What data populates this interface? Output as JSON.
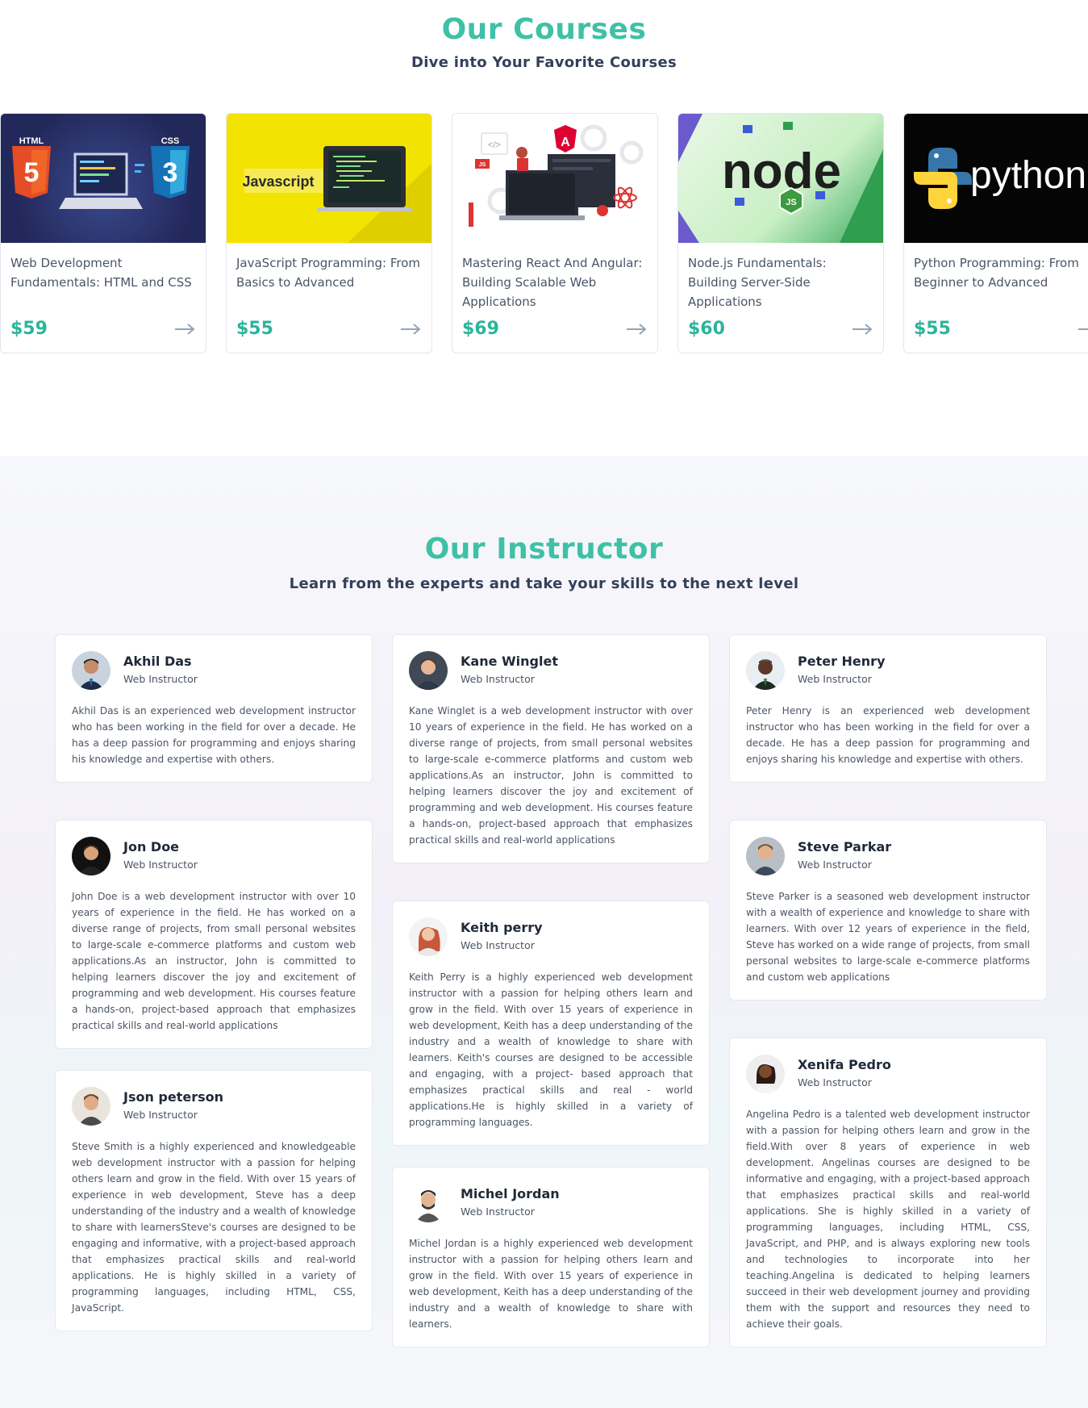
{
  "courses_section": {
    "title": "Our Courses",
    "subtitle": "Dive into Your Favorite Courses",
    "courses": [
      {
        "name": "Web Development Fundamentals: HTML and CSS",
        "price": "$59",
        "thumb_text": [
          "HTML",
          "CSS"
        ]
      },
      {
        "name": "JavaScript Programming: From Basics to Advanced",
        "price": "$55",
        "thumb_text": [
          "Javascript"
        ]
      },
      {
        "name": "Mastering React And Angular: Building Scalable Web Applications",
        "price": "$69",
        "thumb_text": [
          "</>",
          "JS"
        ]
      },
      {
        "name": "Node.js Fundamentals: Building Server-Side Applications",
        "price": "$60",
        "thumb_text": [
          "node",
          "JS"
        ]
      },
      {
        "name": "Python Programming: From Beginner to Advanced",
        "price": "$55",
        "thumb_text": [
          "python"
        ]
      }
    ]
  },
  "instructors_section": {
    "title": "Our Instructor",
    "subtitle": "Learn from the experts and take your skills to the next level",
    "instructors": [
      {
        "name": "Akhil Das",
        "role": "Web Instructor",
        "bio": "Akhil Das is an experienced web development instructor who has been working in the field for over a decade. He has a deep passion for programming and enjoys sharing his knowledge and expertise with others."
      },
      {
        "name": "Jon Doe",
        "role": "Web Instructor",
        "bio": "John Doe is a web development instructor with over 10 years of experience in the field. He has worked on a diverse range of projects, from small personal websites to large-scale e-commerce platforms and custom web applications.As an instructor, John is committed to helping learners discover the joy and excitement of programming and web development. His courses feature a hands-on, project-based approach that emphasizes practical skills and real-world applications"
      },
      {
        "name": "Json peterson",
        "role": "Web Instructor",
        "bio": "Steve Smith is a highly experienced and knowledgeable web development instructor with a passion for helping others learn and grow in the field. With over 15 years of experience in web development, Steve has a deep understanding of the industry and a wealth of knowledge to share with learnersSteve's courses are designed to be engaging and informative, with a project-based approach that emphasizes practical skills and real-world applications. He is highly skilled in a variety of programming languages, including HTML, CSS, JavaScript."
      },
      {
        "name": "Kane Winglet",
        "role": "Web Instructor",
        "bio": "Kane Winglet is a web development instructor with over 10 years of experience in the field. He has worked on a diverse range of projects, from small personal websites to large-scale e-commerce platforms and custom web applications.As an instructor, John is committed to helping learners discover the joy and excitement of programming and web development. His courses feature a hands-on, project-based approach that emphasizes practical skills and real-world applications"
      },
      {
        "name": "Keith perry",
        "role": "Web Instructor",
        "bio": "Keith Perry is a highly experienced web development instructor with a passion for helping others learn and grow in the field. With over 15 years of experience in web development, Keith has a deep understanding of the industry and a wealth of knowledge to share with learners. Keith's courses are designed to be accessible and engaging, with a project- based approach that emphasizes practical skills and real - world applications.He is highly skilled in a variety of programming languages."
      },
      {
        "name": "Michel Jordan",
        "role": "Web Instructor",
        "bio": "Michel Jordan is a highly experienced web development instructor with a passion for helping others learn and grow in the field. With over 15 years of experience in web development, Keith has a deep understanding of the industry and a wealth of knowledge to share with learners."
      },
      {
        "name": "Peter Henry",
        "role": "Web Instructor",
        "bio": "Peter Henry is an experienced web development instructor who has been working in the field for over a decade. He has a deep passion for programming and enjoys sharing his knowledge and expertise with others."
      },
      {
        "name": "Steve Parkar",
        "role": "Web Instructor",
        "bio": "Steve Parker is a seasoned web development instructor with a wealth of experience and knowledge to share with learners. With over 12 years of experience in the field, Steve has worked on a wide range of projects, from small personal websites to large-scale e-commerce platforms and custom web applications"
      },
      {
        "name": "Xenifa Pedro",
        "role": "Web Instructor",
        "bio": "Angelina Pedro is a talented web development instructor with a passion for helping others learn and grow in the field.With over 8 years of experience in web development. Angelinas courses are designed to be informative and engaging, with a project-based approach that emphasizes practical skills and real-world applications. She is highly skilled in a variety of programming languages, including HTML, CSS, JavaScript, and PHP, and is always exploring new tools and technologies to incorporate into her teaching.Angelina is dedicated to helping learners succeed in their web development journey and providing them with the support and resources they need to achieve their goals."
      }
    ]
  },
  "colors": {
    "accent": "#3ec1a6",
    "price": "#2bb59a",
    "heading": "#34405a"
  }
}
